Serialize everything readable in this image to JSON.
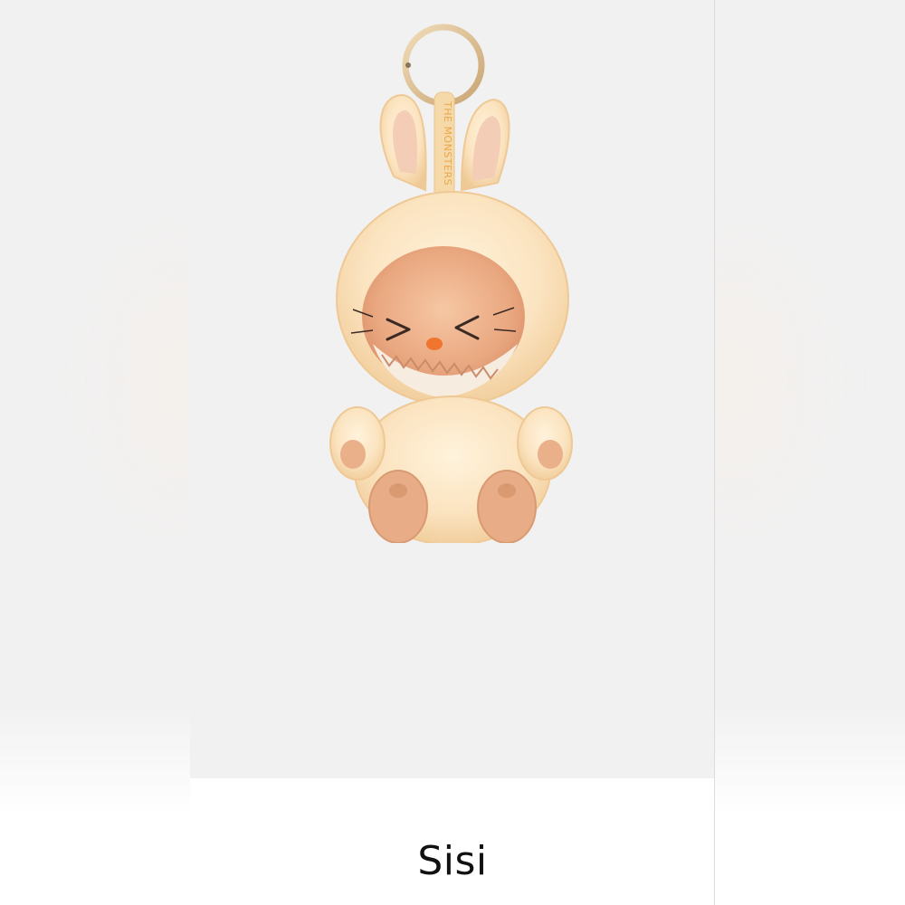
{
  "product": {
    "name": "Sisi",
    "strap_text": "THE MONSTERS",
    "image_icon": "plush-keychain-illustration"
  },
  "colors": {
    "background": "#f1f1f1",
    "card": "#ffffff",
    "plush_fur": "#fbe3bf",
    "plush_shadow": "#f2cc9a",
    "ear_inner": "#f3cdb6",
    "face": "#e9a77f",
    "strap": "#f6d9a8",
    "strap_text": "#e8a64a",
    "ring": "#d9b98a",
    "title_text": "#111111"
  }
}
